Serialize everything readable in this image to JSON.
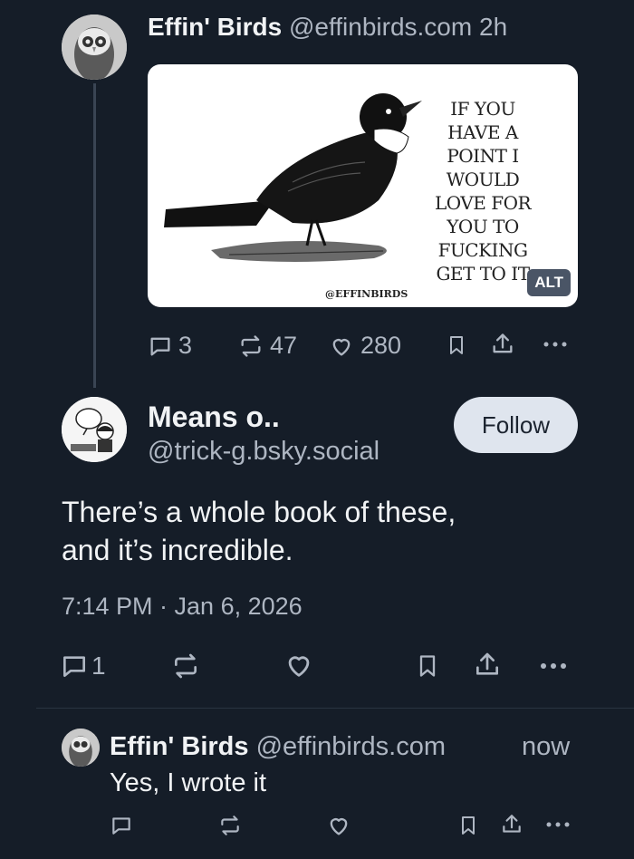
{
  "post1": {
    "author": "Effin' Birds",
    "handle": "@effinbirds.com",
    "time": "2h",
    "image": {
      "text_lines": [
        "IF YOU",
        "HAVE A",
        "POINT I",
        "WOULD",
        "LOVE FOR",
        "YOU TO",
        "FUCKING",
        "GET TO IT"
      ],
      "watermark": "@EFFINBIRDS",
      "alt_label": "ALT"
    },
    "actions": {
      "replies": "3",
      "reposts": "47",
      "likes": "280"
    }
  },
  "post2": {
    "author": "Means o..",
    "handle": "@trick-g.bsky.social",
    "follow_label": "Follow",
    "body_line1": "There’s a whole book of these,",
    "body_line2": "and it’s incredible.",
    "timestamp": "7:14 PM · Jan 6, 2026",
    "actions": {
      "replies": "1"
    }
  },
  "post3": {
    "author": "Effin' Birds",
    "handle": "@effinbirds.com",
    "time": "now",
    "body": "Yes, I wrote it"
  },
  "colors": {
    "background": "#151d28",
    "text": "#f1f3f5",
    "muted": "#aeb6c2",
    "button": "#dfe5ee"
  }
}
